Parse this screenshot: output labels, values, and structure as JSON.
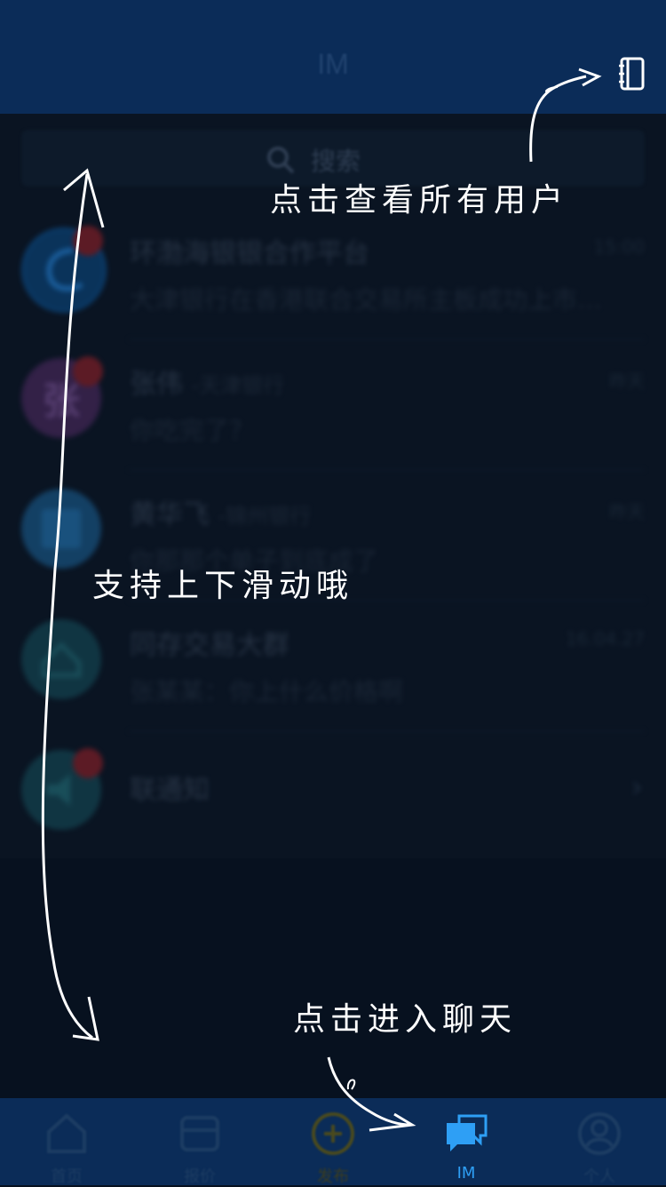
{
  "header": {
    "title": "IM"
  },
  "search": {
    "placeholder": "搜索"
  },
  "chats": [
    {
      "title": "环渤海银银合作平台",
      "subtitle": "大津银行在香港联合交易所主板成功上市…",
      "time": "15:00",
      "avatar_text": "",
      "avatar_color": "#0a3a67"
    },
    {
      "title": "张伟",
      "org": "-天津银行",
      "subtitle": "你吃完了？",
      "time": "昨天",
      "avatar_text": "张",
      "avatar_color": "#3c2450"
    },
    {
      "title": "黄华飞",
      "org": "-锦州银行",
      "subtitle": "你那那个单子到底成了",
      "time": "昨天",
      "avatar_text": "",
      "avatar_color": "#164a73"
    },
    {
      "title": "同存交易大群",
      "org": "",
      "subtitle": "张某某：你上什么价格啊",
      "time": "16.04.27",
      "avatar_text": "",
      "avatar_color": "#123d4a"
    },
    {
      "title": "联通知",
      "org": "",
      "subtitle": "",
      "time": "",
      "avatar_text": "",
      "avatar_color": "#123d4a"
    }
  ],
  "tabs": [
    {
      "label": "首页",
      "icon": "home-icon"
    },
    {
      "label": "报价",
      "icon": "store-icon"
    },
    {
      "label": "发布",
      "icon": "add-icon"
    },
    {
      "label": "IM",
      "icon": "chat-icon"
    },
    {
      "label": "个人",
      "icon": "profile-icon"
    }
  ],
  "hints": {
    "view_users": "点击查看所有用户",
    "swipe": "支持上下滑动哦",
    "enter_chat": "点击进入聊天"
  },
  "colors": {
    "header_bg": "#0b2c58",
    "active_tab": "#2e9ff5",
    "badge": "#b7343f",
    "overlay_text": "#ffffff"
  }
}
